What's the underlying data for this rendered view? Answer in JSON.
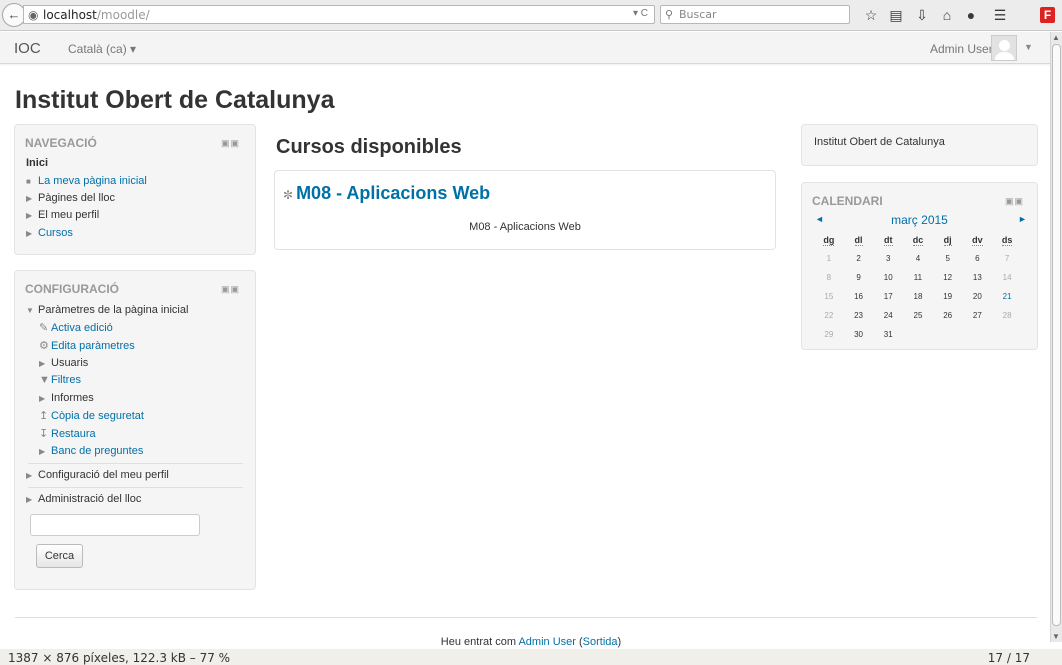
{
  "browser": {
    "url_host": "localhost",
    "url_path": "/moodle/",
    "search_placeholder": "Buscar",
    "toolbar_icons": [
      "bookmark-star-icon",
      "clipboard-icon",
      "download-icon",
      "home-icon",
      "chat-icon",
      "menu-icon",
      "f-addon-icon"
    ]
  },
  "navbar": {
    "brand": "IOC",
    "language": "Català (ca) ▾",
    "user_name": "Admin User"
  },
  "site_title": "Institut Obert de Catalunya",
  "navigation_block": {
    "title": "NAVEGACIÓ",
    "home": "Inici",
    "items": [
      "La meva pàgina inicial",
      "Pàgines del lloc",
      "El meu perfil",
      "Cursos"
    ]
  },
  "settings_block": {
    "title": "CONFIGURACIÓ",
    "section": "Paràmetres de la pàgina inicial",
    "items": [
      "Activa edició",
      "Edita paràmetres",
      "Usuaris",
      "Filtres",
      "Informes",
      "Còpia de seguretat",
      "Restaura",
      "Banc de preguntes"
    ],
    "profile_settings": "Configuració del meu perfil",
    "site_admin": "Administració del lloc",
    "search_button": "Cerca"
  },
  "main": {
    "heading": "Cursos disponibles",
    "course_name": "M08 - Aplicacions Web",
    "course_summary": "M08 - Aplicacions Web"
  },
  "html_block": {
    "text": "Institut Obert de Catalunya"
  },
  "calendar": {
    "title": "CALENDARI",
    "month": "març 2015",
    "prev": "◄",
    "next": "►",
    "weekdays": [
      "dg",
      "dl",
      "dt",
      "dc",
      "dj",
      "dv",
      "ds"
    ],
    "weeks": [
      [
        "1",
        "2",
        "3",
        "4",
        "5",
        "6",
        "7"
      ],
      [
        "8",
        "9",
        "10",
        "11",
        "12",
        "13",
        "14"
      ],
      [
        "15",
        "16",
        "17",
        "18",
        "19",
        "20",
        "21"
      ],
      [
        "22",
        "23",
        "24",
        "25",
        "26",
        "27",
        "28"
      ],
      [
        "29",
        "30",
        "31",
        "",
        "",
        "",
        ""
      ]
    ],
    "today": "21"
  },
  "footer": {
    "prefix": "Heu entrat com ",
    "user": "Admin User",
    "logout": "Sortida",
    "open_paren": " (",
    "close_paren": ")"
  },
  "statusbar": {
    "left": "1387 × 876 píxeles, 122.3 kB – 77 %",
    "right": "17 / 17"
  }
}
